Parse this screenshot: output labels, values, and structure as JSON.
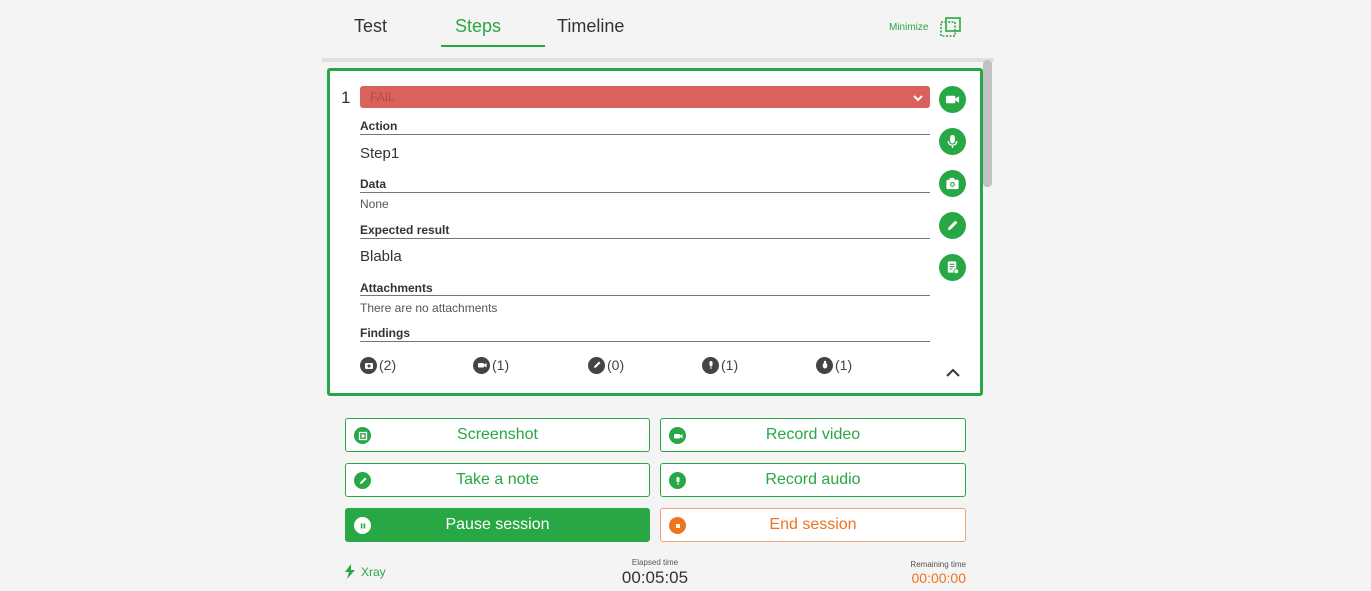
{
  "tabs": [
    {
      "label": "Test",
      "active": false
    },
    {
      "label": "Steps",
      "active": true
    },
    {
      "label": "Timeline",
      "active": false
    }
  ],
  "minimize_label": "Minimize",
  "step": {
    "number": "1",
    "status": "FAIL",
    "fields": {
      "action_label": "Action",
      "action_value": "Step1",
      "data_label": "Data",
      "data_value": "None",
      "expected_label": "Expected result",
      "expected_value": "Blabla",
      "attachments_label": "Attachments",
      "attachments_value": "There are no attachments",
      "findings_label": "Findings"
    },
    "findings": [
      {
        "icon": "camera-icon",
        "count": "(2)"
      },
      {
        "icon": "video-icon",
        "count": "(1)"
      },
      {
        "icon": "pencil-icon",
        "count": "(0)"
      },
      {
        "icon": "microphone-icon",
        "count": "(1)"
      },
      {
        "icon": "bug-icon",
        "count": "(1)"
      }
    ]
  },
  "actions": {
    "screenshot": "Screenshot",
    "record_video": "Record video",
    "take_note": "Take a note",
    "record_audio": "Record audio",
    "pause_session": "Pause session",
    "end_session": "End session"
  },
  "footer": {
    "brand": "Xray",
    "elapsed_label": "Elapsed time",
    "elapsed_time": "00:05:05",
    "remaining_label": "Remaining time",
    "remaining_time": "00:00:00"
  },
  "colors": {
    "accent": "#28a745",
    "fail": "#d9625b",
    "danger": "#f0731e"
  }
}
